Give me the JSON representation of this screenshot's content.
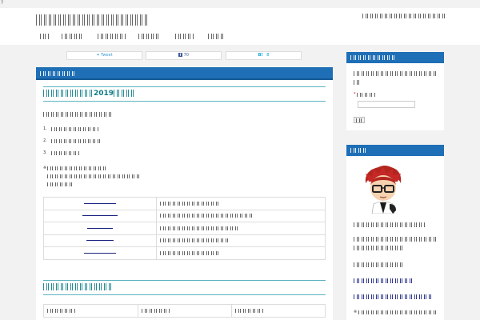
{
  "topbar": {
    "mark": "?"
  },
  "header": {
    "site_title": "",
    "site_description": "",
    "nav": [
      {
        "label": ""
      },
      {
        "label": ""
      },
      {
        "label": ""
      },
      {
        "label": ""
      },
      {
        "label": ""
      },
      {
        "label": ""
      }
    ]
  },
  "share": [
    {
      "icon": "twitter-bird-icon",
      "label": "Tweet"
    },
    {
      "icon": "facebook-f-icon",
      "label": "70"
    },
    {
      "icon": "hatena-b-icon",
      "label": "B!",
      "count": "8"
    }
  ],
  "article": {
    "category": "",
    "section1_title_prefix": "",
    "section1_title_year": "2019",
    "section1_title_suffix": "",
    "intro": "",
    "list": [
      {
        "num": "1.",
        "text": ""
      },
      {
        "num": "2.",
        "text": ""
      },
      {
        "num": "3.",
        "text": ""
      }
    ],
    "note_mark": "※",
    "note_lines": [
      "",
      "",
      ""
    ],
    "link_table": [
      {
        "link": "",
        "desc": ""
      },
      {
        "link": "",
        "desc": ""
      },
      {
        "link": "",
        "desc": ""
      },
      {
        "link": "",
        "desc": ""
      },
      {
        "link": "",
        "desc": ""
      }
    ],
    "section2_title": "",
    "compare_headers": [
      "",
      "",
      ""
    ]
  },
  "sidebar": {
    "contact": {
      "title": "",
      "text_line1": "",
      "text_line2": "",
      "required_mark": "*",
      "field_label": "",
      "submit_label": ""
    },
    "profile": {
      "title": "",
      "avatar_icon": "avatar-illustration-icon",
      "lines": [
        "",
        "",
        "",
        ""
      ],
      "links": [
        "",
        ""
      ],
      "footer_mark": "※",
      "footer_text": ""
    }
  },
  "colors": {
    "accent_blue": "#1f6fb6",
    "heading_teal": "#0e7c86",
    "link_navy": "#1a237e",
    "page_bg": "#f2f2f2"
  }
}
